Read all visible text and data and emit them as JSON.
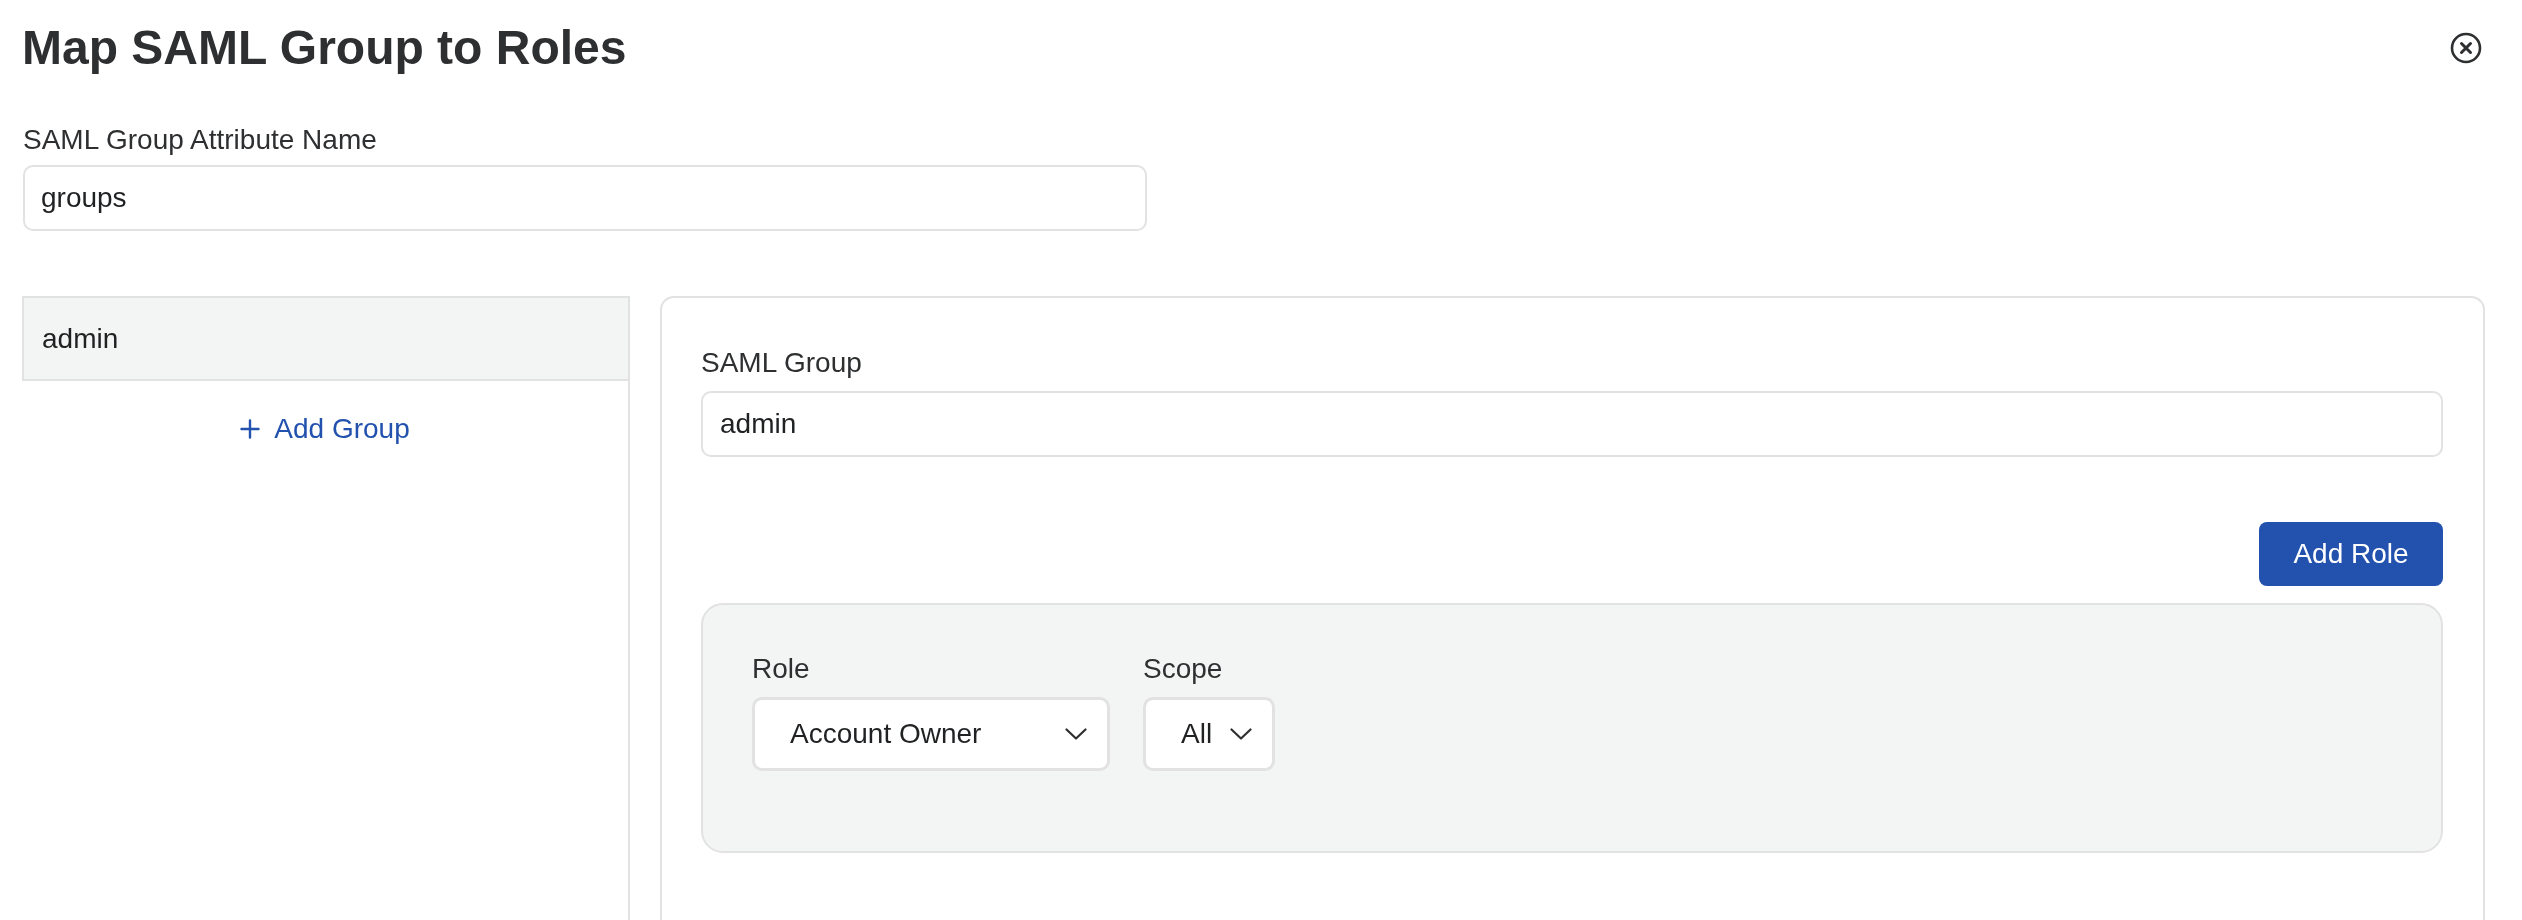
{
  "dialog": {
    "title": "Map SAML Group to Roles"
  },
  "attribute_field": {
    "label": "SAML Group Attribute Name",
    "value": "groups"
  },
  "groups": {
    "items": [
      {
        "label": "admin",
        "selected": true
      }
    ],
    "add_link": "Add Group"
  },
  "group_editor": {
    "name_field": {
      "label": "SAML Group",
      "value": "admin"
    },
    "add_role_button": "Add Role",
    "roles": [
      {
        "fields": [
          {
            "kind": "wide",
            "label": "Role",
            "value": "Account Owner"
          },
          {
            "kind": "narrow",
            "label": "Scope",
            "value": "All"
          }
        ]
      }
    ]
  }
}
